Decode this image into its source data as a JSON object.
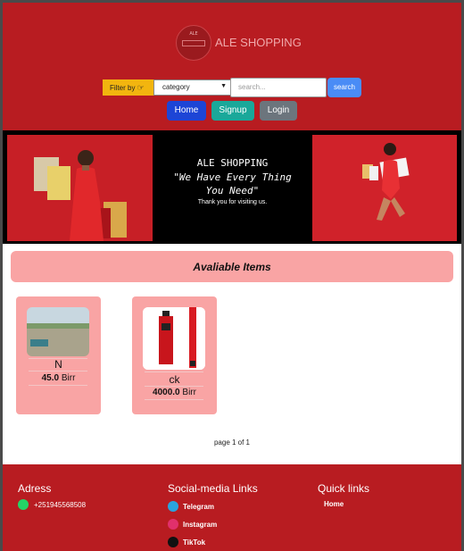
{
  "brand": {
    "name": "ALE SHOPPING",
    "logo_text": "ALE"
  },
  "search": {
    "filter_label": "Filter by",
    "category_selected": "category",
    "placeholder": "search...",
    "button_label": "search"
  },
  "nav": {
    "home": "Home",
    "signup": "Signup",
    "login": "Login"
  },
  "hero": {
    "title": "ALE SHOPPING",
    "slogan_line1": "\"We Have Every Thing",
    "slogan_line2": "You Need\"",
    "thanks": "Thank you for visiting us."
  },
  "section_title": "Avaliable Items",
  "items": [
    {
      "name": "N",
      "price": "45.0",
      "currency": "Birr"
    },
    {
      "name": "ck",
      "price": "4000.0",
      "currency": "Birr"
    }
  ],
  "pager": "page 1 of 1",
  "footer": {
    "address_heading": "Adress",
    "phone": "+251945568508",
    "social_heading": "Social-media Links",
    "social": [
      "Telegram",
      "Instagram",
      "TikTok"
    ],
    "quick_heading": "Quick links",
    "quick": [
      "Home"
    ]
  },
  "colors": {
    "primary_red": "#b81c21",
    "accent_pink": "#f9a4a4",
    "filter_yellow": "#f2b50f",
    "search_blue": "#4a8cf6",
    "home_blue": "#1d45d6",
    "signup_teal": "#1aa89a",
    "login_gray": "#6c757d"
  }
}
